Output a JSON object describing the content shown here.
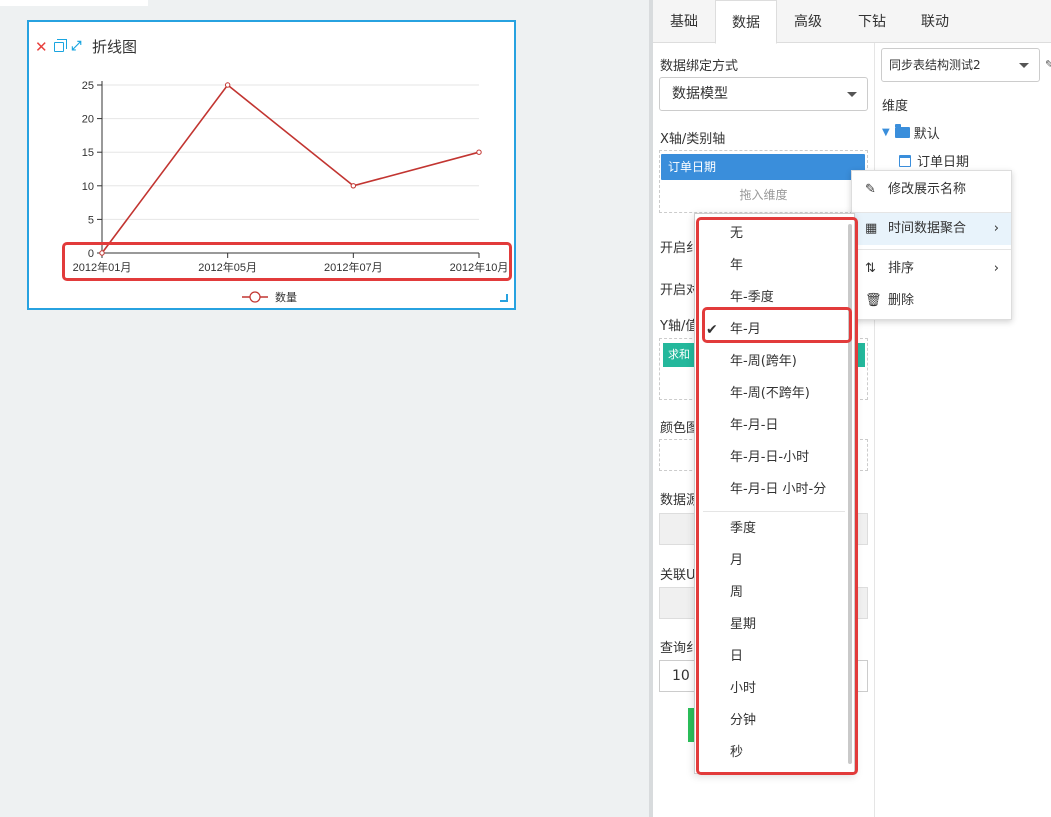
{
  "widget": {
    "title": "折线图",
    "icons": [
      "close-icon",
      "copy-icon",
      "expand-icon"
    ]
  },
  "chart_data": {
    "type": "line",
    "title": "折线图",
    "categories": [
      "2012年01月",
      "2012年05月",
      "2012年07月",
      "2012年10月"
    ],
    "series": [
      {
        "name": "数量",
        "values": [
          0,
          25,
          10,
          15
        ],
        "color": "#c23531"
      }
    ],
    "yticks": [
      "0",
      "5",
      "10",
      "15",
      "20",
      "25"
    ],
    "ylim": [
      0,
      25
    ],
    "grid": true,
    "legend_position": "bottom"
  },
  "tabs": [
    "基础",
    "数据",
    "高级",
    "下钻",
    "联动"
  ],
  "active_tab": "数据",
  "form": {
    "binding_label": "数据绑定方式",
    "binding_value": "数据模型",
    "xaxis_label": "X轴/类别轴",
    "xaxis_field": "订单日期",
    "drop_hint": "拖入维度",
    "open1": "开启纟",
    "open2": "开启对",
    "yaxis_label": "Y轴/值",
    "y_pill": "求和",
    "color_label": "颜色图",
    "data_label": "数据源",
    "relate_label": "关联U",
    "query_label": "查询纟",
    "query_value": "10"
  },
  "datasource": {
    "selected": "同步表结构测试2",
    "dimension_title": "维度",
    "folder": "默认",
    "field": "订单日期"
  },
  "context_menu": {
    "items": [
      {
        "label": "修改展示名称",
        "icon": "edit-icon"
      },
      {
        "label": "时间数据聚合",
        "icon": "calendar-icon"
      },
      {
        "label": "排序",
        "icon": "sort-icon"
      },
      {
        "label": "删除",
        "icon": "trash-icon"
      }
    ]
  },
  "time_agg_menu": {
    "selected": "年-月",
    "group1": [
      "无",
      "年",
      "年-季度",
      "年-月",
      "年-周(跨年)",
      "年-周(不跨年)",
      "年-月-日",
      "年-月-日-小时",
      "年-月-日 小时-分"
    ],
    "group2": [
      "季度",
      "月",
      "周",
      "星期",
      "日",
      "小时",
      "分钟",
      "秒"
    ]
  },
  "colors": {
    "accent": "#27a2e0",
    "highlight_box": "#e23b3b",
    "series": "#c23531",
    "field_pill": "#3a8edb",
    "measure_pill": "#24b89c"
  }
}
